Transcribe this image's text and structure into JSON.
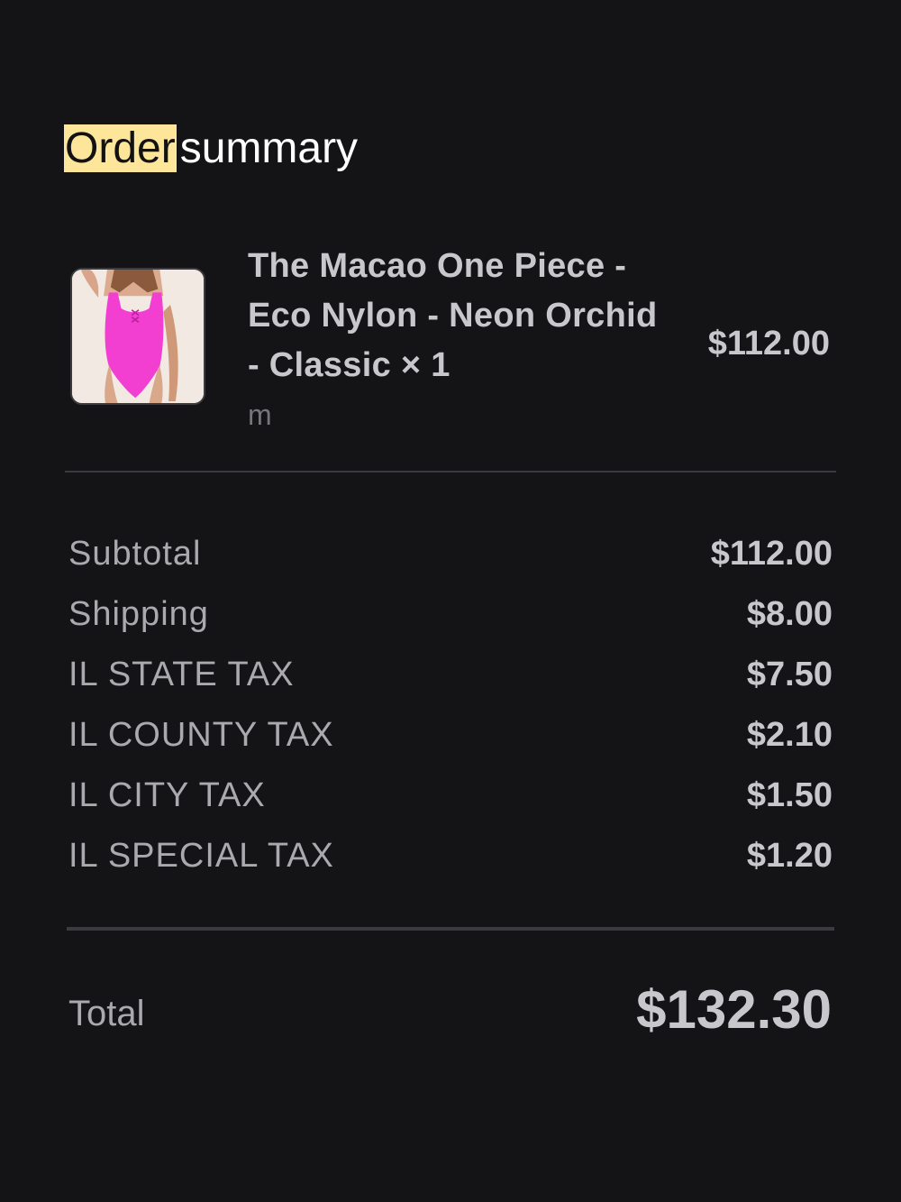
{
  "header": {
    "title_highlight": "Order",
    "title_rest": "summary"
  },
  "product": {
    "name": "The Macao One Piece - Eco Nylon - Neon Orchid - Classic × 1",
    "variant": "m",
    "price": "$112.00",
    "image_icon": "swimsuit-product-image",
    "swimsuit_color": "#f23fd2"
  },
  "summary": {
    "rows": [
      {
        "label": "Subtotal",
        "value": "$112.00"
      },
      {
        "label": "Shipping",
        "value": "$8.00"
      },
      {
        "label": "IL STATE TAX",
        "value": "$7.50"
      },
      {
        "label": "IL COUNTY TAX",
        "value": "$2.10"
      },
      {
        "label": "IL CITY TAX",
        "value": "$1.50"
      },
      {
        "label": "IL SPECIAL TAX",
        "value": "$1.20"
      }
    ],
    "total_label": "Total",
    "total_value": "$132.30"
  },
  "colors": {
    "background": "#141416",
    "highlight": "#fde59a",
    "divider": "#3b3b3f"
  }
}
